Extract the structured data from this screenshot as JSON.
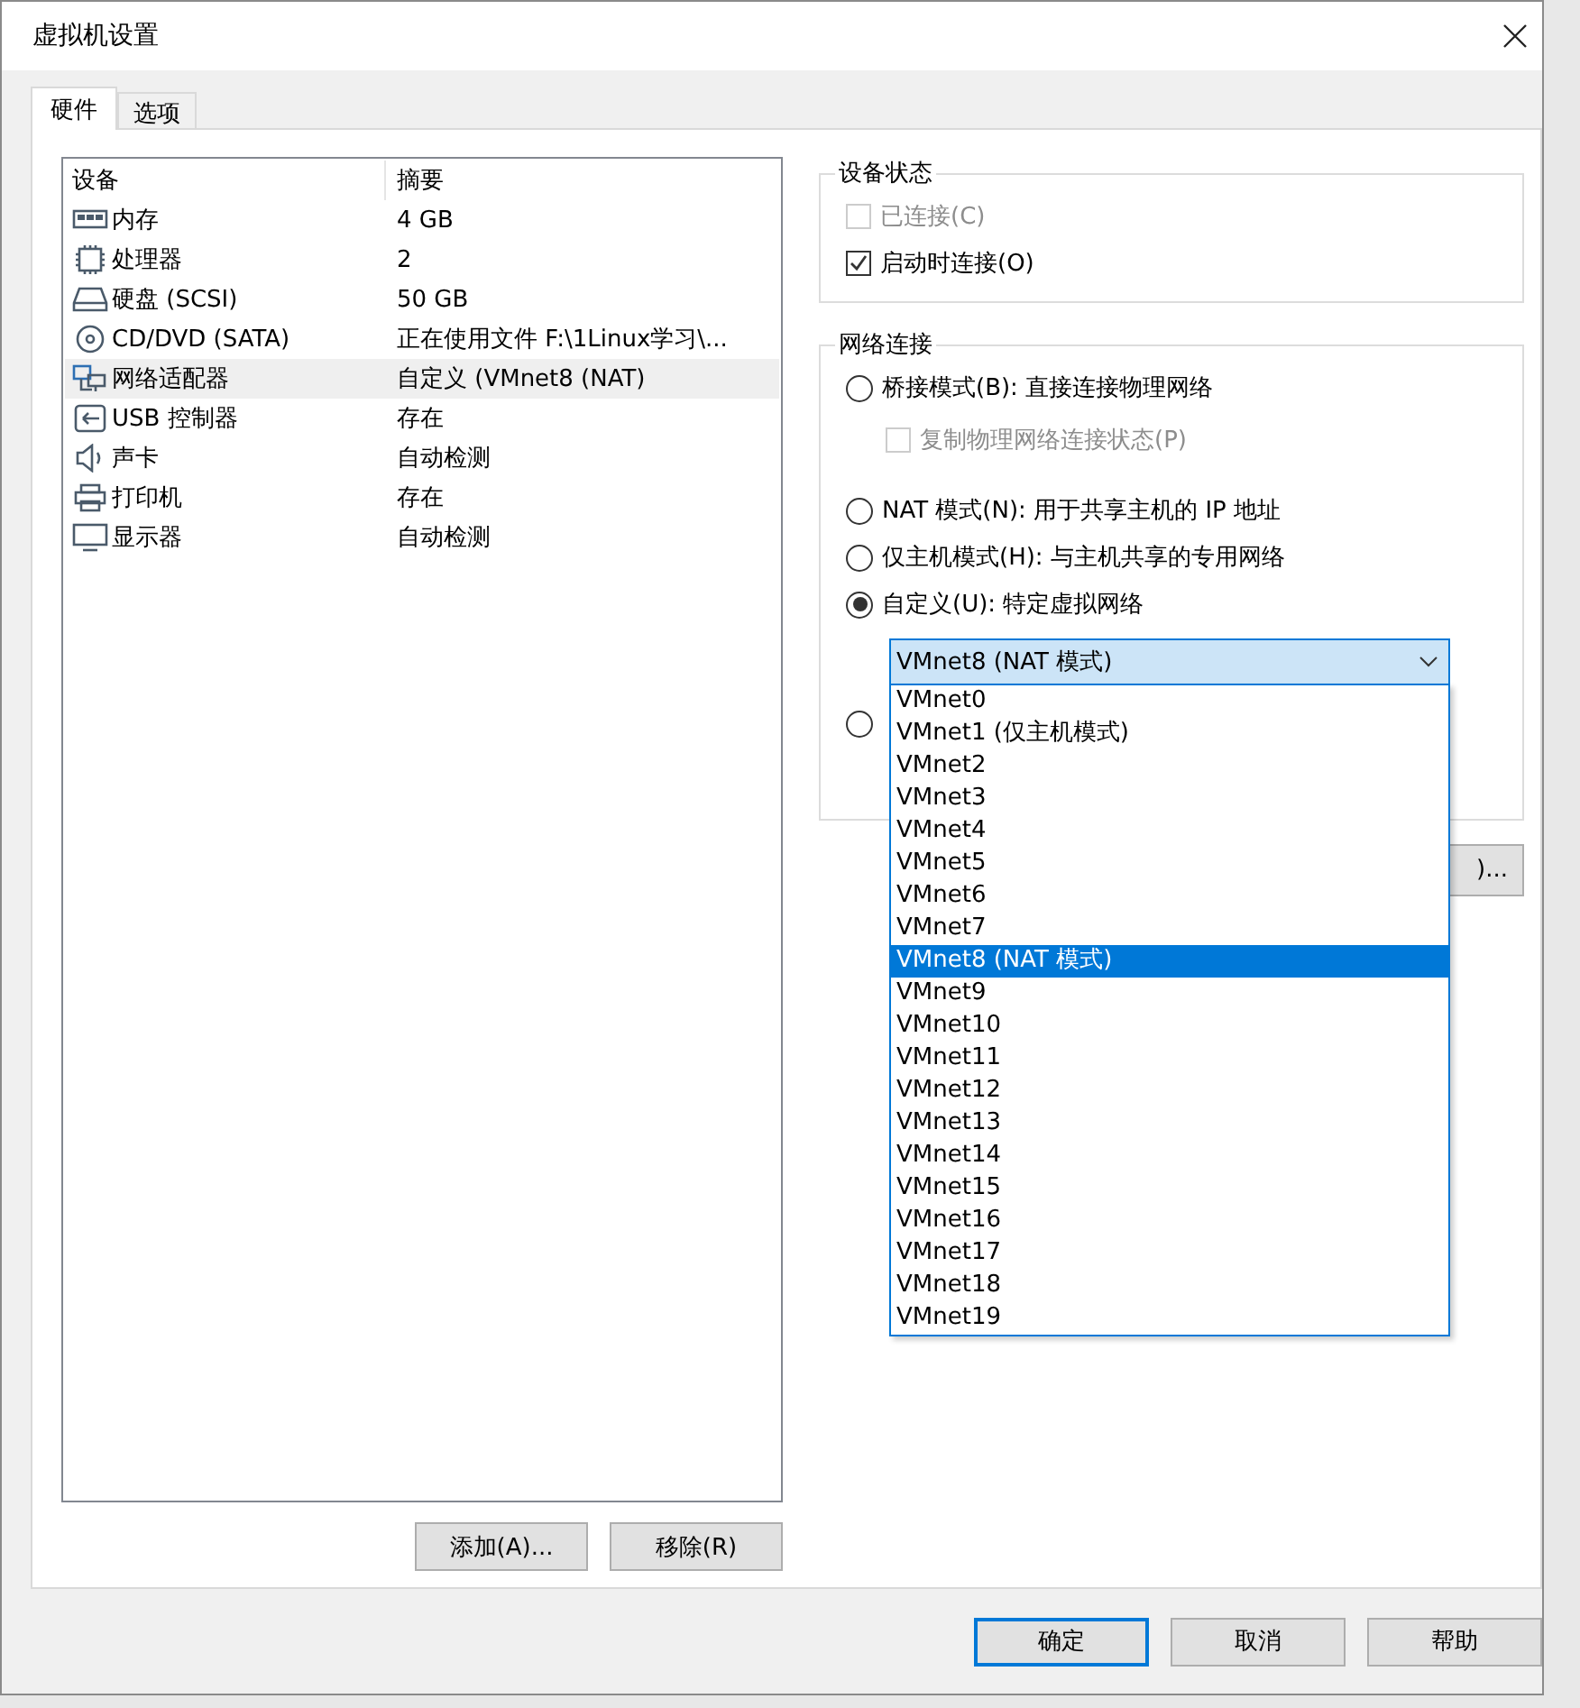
{
  "window": {
    "title": "虚拟机设置"
  },
  "tabs": [
    {
      "label": "硬件",
      "selected": true
    },
    {
      "label": "选项",
      "selected": false
    }
  ],
  "devices": {
    "columns": [
      "设备",
      "摘要"
    ],
    "rows": [
      {
        "kind": "memory",
        "name": "内存",
        "summary": "4 GB",
        "selected": false
      },
      {
        "kind": "processor",
        "name": "处理器",
        "summary": "2",
        "selected": false
      },
      {
        "kind": "disk",
        "name": "硬盘 (SCSI)",
        "summary": "50 GB",
        "selected": false
      },
      {
        "kind": "cd",
        "name": "CD/DVD (SATA)",
        "summary": "正在使用文件 F:\\1Linux学习\\...",
        "selected": false
      },
      {
        "kind": "network",
        "name": "网络适配器",
        "summary": "自定义 (VMnet8 (NAT)",
        "selected": true
      },
      {
        "kind": "usb",
        "name": "USB 控制器",
        "summary": "存在",
        "selected": false
      },
      {
        "kind": "sound",
        "name": "声卡",
        "summary": "自动检测",
        "selected": false
      },
      {
        "kind": "printer",
        "name": "打印机",
        "summary": "存在",
        "selected": false
      },
      {
        "kind": "display",
        "name": "显示器",
        "summary": "自动检测",
        "selected": false
      }
    ]
  },
  "list_buttons": [
    "添加(A)...",
    "移除(R)"
  ],
  "device_status": {
    "title": "设备状态",
    "options": [
      {
        "label": "已连接(C)",
        "checked": false,
        "disabled": true
      },
      {
        "label": "启动时连接(O)",
        "checked": true,
        "disabled": false
      }
    ]
  },
  "network": {
    "title": "网络连接",
    "options": [
      {
        "kind": "radio",
        "label": "桥接模式(B): 直接连接物理网络",
        "selected": false
      },
      {
        "kind": "checkbox",
        "label": "复制物理网络连接状态(P)",
        "checked": false,
        "disabled": true
      },
      {
        "kind": "radio",
        "label": "NAT 模式(N): 用于共享主机的 IP 地址",
        "selected": false
      },
      {
        "kind": "radio",
        "label": "仅主机模式(H): 与主机共享的专用网络",
        "selected": false
      },
      {
        "kind": "radio",
        "label": "自定义(U): 特定虚拟网络",
        "selected": true
      },
      {
        "kind": "radio",
        "selected": false
      }
    ],
    "combo": {
      "value": "VMnet8 (NAT 模式)",
      "items": [
        {
          "label": "VMnet0",
          "selected": false
        },
        {
          "label": "VMnet1 (仅主机模式)",
          "selected": false
        },
        {
          "label": "VMnet2",
          "selected": false
        },
        {
          "label": "VMnet3",
          "selected": false
        },
        {
          "label": "VMnet4",
          "selected": false
        },
        {
          "label": "VMnet5",
          "selected": false
        },
        {
          "label": "VMnet6",
          "selected": false
        },
        {
          "label": "VMnet7",
          "selected": false
        },
        {
          "label": "VMnet8 (NAT 模式)",
          "selected": true
        },
        {
          "label": "VMnet9",
          "selected": false
        },
        {
          "label": "VMnet10",
          "selected": false
        },
        {
          "label": "VMnet11",
          "selected": false
        },
        {
          "label": "VMnet12",
          "selected": false
        },
        {
          "label": "VMnet13",
          "selected": false
        },
        {
          "label": "VMnet14",
          "selected": false
        },
        {
          "label": "VMnet15",
          "selected": false
        },
        {
          "label": "VMnet16",
          "selected": false
        },
        {
          "label": "VMnet17",
          "selected": false
        },
        {
          "label": "VMnet18",
          "selected": false
        },
        {
          "label": "VMnet19",
          "selected": false
        }
      ]
    },
    "covered_button": {
      "label": ")..."
    }
  },
  "footer_buttons": [
    {
      "label": "确定",
      "default": true
    },
    {
      "label": "取消",
      "default": false
    },
    {
      "label": "帮助",
      "default": false
    }
  ]
}
